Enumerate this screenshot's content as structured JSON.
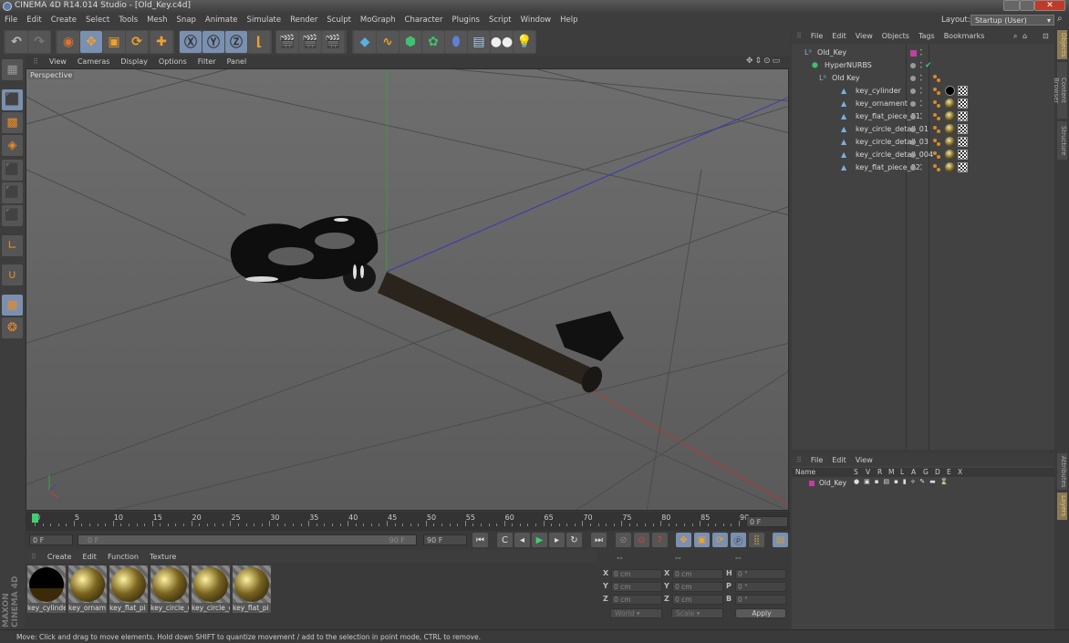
{
  "window": {
    "title": "CINEMA 4D R14.014 Studio - [Old_Key.c4d]"
  },
  "menubar": {
    "items": [
      "File",
      "Edit",
      "Create",
      "Select",
      "Tools",
      "Mesh",
      "Snap",
      "Animate",
      "Simulate",
      "Render",
      "Sculpt",
      "MoGraph",
      "Character",
      "Plugins",
      "Script",
      "Window",
      "Help"
    ]
  },
  "layout": {
    "label": "Layout:",
    "value": "Startup (User)"
  },
  "toolbar": {
    "icons": [
      "undo-icon",
      "redo-icon",
      "live-select-icon",
      "move-icon",
      "scale-icon",
      "rotate-icon",
      "add-icon",
      "x-axis-icon",
      "y-axis-icon",
      "z-axis-icon",
      "coordinate-system-icon",
      "render-view-icon",
      "render-picture-viewer-icon",
      "render-settings-icon",
      "cube-icon",
      "spline-icon",
      "nurbs-icon",
      "array-icon",
      "deformer-icon",
      "floor-icon",
      "camera-icon",
      "light-icon"
    ]
  },
  "left_tools": {
    "icons": [
      "make-editable-icon",
      "model-mode-icon",
      "texture-mode-icon",
      "workplane-mode-icon",
      "points-mode-icon",
      "edges-mode-icon",
      "polygons-mode-icon",
      "axis-mode-icon",
      "snap-icon",
      "workplane-lock-icon",
      "sculpt-icon"
    ]
  },
  "viewport": {
    "menu": [
      "View",
      "Cameras",
      "Display",
      "Options",
      "Filter",
      "Panel"
    ],
    "label": "Perspective"
  },
  "timeline": {
    "ticks": [
      "0",
      "5",
      "10",
      "15",
      "20",
      "25",
      "30",
      "35",
      "40",
      "45",
      "50",
      "55",
      "60",
      "65",
      "70",
      "75",
      "80",
      "85",
      "90"
    ],
    "current_frame_field": "0 F",
    "start_field": "0 F",
    "range_start": "0 F",
    "range_end": "90 F",
    "end_field": "90 F",
    "current_frame": 0,
    "max_frame": 90
  },
  "materials": {
    "menu": [
      "Create",
      "Edit",
      "Function",
      "Texture"
    ],
    "items": [
      {
        "label": "key_cylinde",
        "style": "dark"
      },
      {
        "label": "key_ornam",
        "style": "gold"
      },
      {
        "label": "key_flat_pi",
        "style": "gold"
      },
      {
        "label": "key_circle_(",
        "style": "gold"
      },
      {
        "label": "key_circle_c",
        "style": "gold"
      },
      {
        "label": "key_flat_pi",
        "style": "gold"
      }
    ]
  },
  "coordinates": {
    "headers": [
      "--",
      "--",
      "--"
    ],
    "rows": [
      {
        "a_label": "X",
        "a_val": "0 cm",
        "b_label": "X",
        "b_val": "0 cm",
        "c_label": "H",
        "c_val": "0 °"
      },
      {
        "a_label": "Y",
        "a_val": "0 cm",
        "b_label": "Y",
        "b_val": "0 cm",
        "c_label": "P",
        "c_val": "0 °"
      },
      {
        "a_label": "Z",
        "a_val": "0 cm",
        "b_label": "Z",
        "b_val": "0 cm",
        "c_label": "B",
        "c_val": "0 °"
      }
    ],
    "mode": "World",
    "scale": "Scale",
    "apply": "Apply"
  },
  "objects": {
    "menu": [
      "File",
      "Edit",
      "View",
      "Objects",
      "Tags",
      "Bookmarks"
    ],
    "tree": [
      {
        "name": "Old_Key",
        "type": "null",
        "depth": 0,
        "tags": [
          "layer-magenta"
        ]
      },
      {
        "name": "HyperNURBS",
        "type": "hypernurbs",
        "depth": 1,
        "tags": [
          "check"
        ]
      },
      {
        "name": "Old Key",
        "type": "null",
        "depth": 2,
        "tags": [
          "phong"
        ]
      },
      {
        "name": "key_cylinder",
        "type": "polygon",
        "depth": 3,
        "tags": [
          "phong",
          "material-dark",
          "uvw"
        ]
      },
      {
        "name": "key_ornament",
        "type": "polygon",
        "depth": 3,
        "tags": [
          "phong",
          "material-gold",
          "uvw"
        ]
      },
      {
        "name": "key_flat_piece_01",
        "type": "polygon",
        "depth": 3,
        "tags": [
          "phong",
          "material-gold",
          "uvw"
        ]
      },
      {
        "name": "key_circle_detail_01",
        "type": "polygon",
        "depth": 3,
        "tags": [
          "phong",
          "material-gold",
          "uvw"
        ]
      },
      {
        "name": "key_circle_detail_03",
        "type": "polygon",
        "depth": 3,
        "tags": [
          "phong",
          "material-gold",
          "uvw"
        ]
      },
      {
        "name": "key_circle_detail_004",
        "type": "polygon",
        "depth": 3,
        "tags": [
          "phong",
          "material-gold",
          "uvw"
        ]
      },
      {
        "name": "key_flat_piece_02",
        "type": "polygon",
        "depth": 3,
        "tags": [
          "phong",
          "material-gold",
          "uvw"
        ]
      }
    ]
  },
  "layers": {
    "menu": [
      "File",
      "Edit",
      "View"
    ],
    "columns": [
      "Name",
      "S",
      "V",
      "R",
      "M",
      "L",
      "A",
      "G",
      "D",
      "E",
      "X"
    ],
    "rows": [
      {
        "name": "Old_Key",
        "color": "#c040a0"
      }
    ]
  },
  "right_tabs": [
    "Objects",
    "Content Browser",
    "Structure",
    "Attributes",
    "Layers"
  ],
  "brand": "MAXON CINEMA 4D",
  "status": "Move: Click and drag to move elements. Hold down SHIFT to quantize movement / add to the selection in point mode, CTRL to remove.",
  "colors": {
    "accent_blue": "#7a90b0",
    "orange": "#e88a28",
    "layer_magenta": "#c040a0",
    "x_axis": "#c04040",
    "y_axis": "#40a040",
    "z_axis": "#4040c0"
  }
}
